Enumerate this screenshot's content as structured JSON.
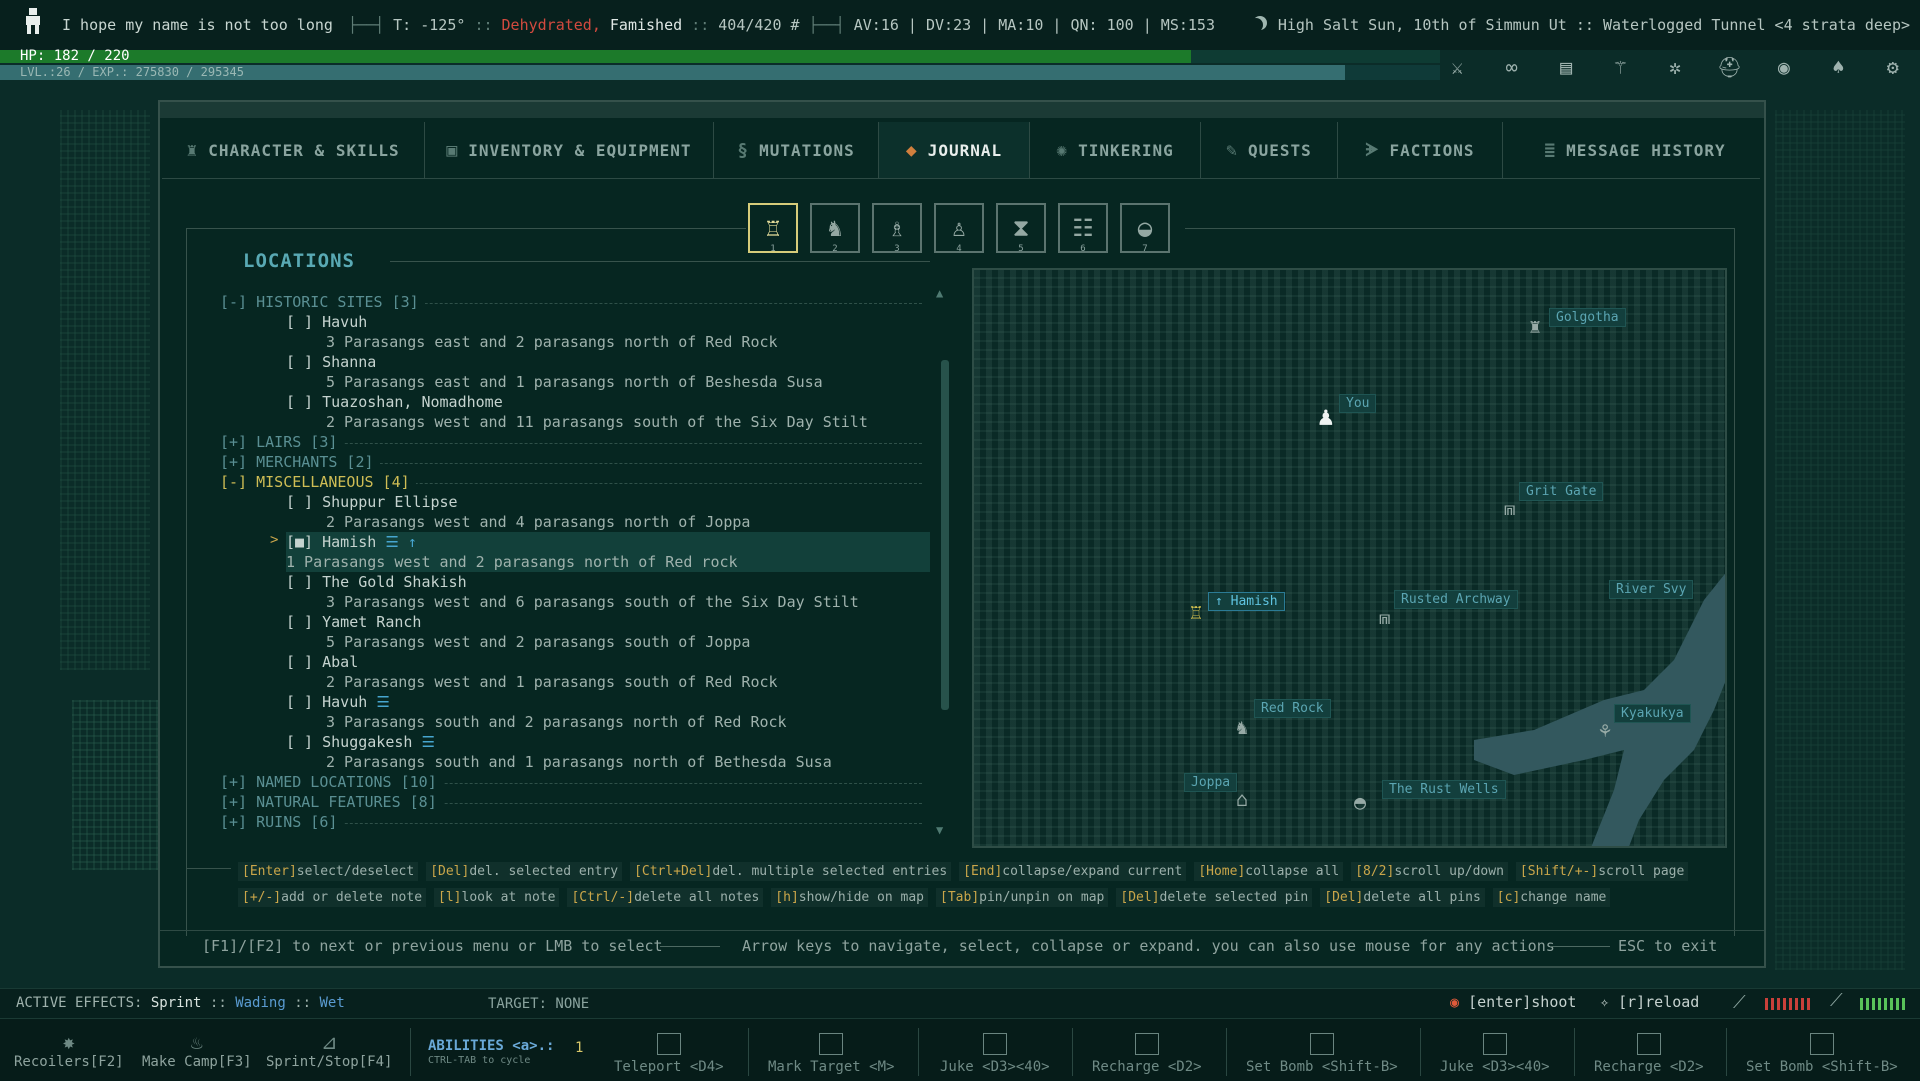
{
  "status": {
    "name": "I hope my name is not too long",
    "temp": "T: -125°",
    "conditions": [
      "Dehydrated,",
      "Famished"
    ],
    "weight": "404/420 #",
    "stats": "AV:16 | DV:23 | MA:10 | QN: 100 | MS:153",
    "date": "High Salt Sun, 10th of Simmun Ut",
    "location": "Waterlogged Tunnel <4 strata deep>",
    "hp_text": "HP: 182 / 220",
    "hp_fraction": 0.827,
    "xp_text": "LVL.:26 / EXP.: 275830 / 295345",
    "xp_fraction": 0.934
  },
  "toolbar_icons": [
    "sword-icon",
    "goggles-icon",
    "tablet-icon",
    "staff-icon",
    "gear-wheel-icon",
    "helmet-icon",
    "globe-icon",
    "hat-icon",
    "settings-icon"
  ],
  "tabs": [
    {
      "label": "CHARACTER & SKILLS",
      "icon": "person-icon"
    },
    {
      "label": "INVENTORY & EQUIPMENT",
      "icon": "chest-icon"
    },
    {
      "label": "MUTATIONS",
      "icon": "dna-icon"
    },
    {
      "label": "JOURNAL",
      "icon": "book-icon",
      "active": true
    },
    {
      "label": "TINKERING",
      "icon": "cog-icon"
    },
    {
      "label": "QUESTS",
      "icon": "quill-icon"
    },
    {
      "label": "FACTIONS",
      "icon": "wings-icon"
    },
    {
      "label": "MESSAGE HISTORY",
      "icon": "list-icon"
    }
  ],
  "subtabs": [
    "1",
    "2",
    "3",
    "4",
    "5",
    "6",
    "7"
  ],
  "locations": {
    "title": "LOCATIONS",
    "historic": {
      "label": "[-] HISTORIC SITES [3]",
      "entries": [
        {
          "name": "[ ] Havuh",
          "desc": "3 Parasangs east and 2 parasangs north of Red Rock"
        },
        {
          "name": "[ ] Shanna",
          "desc": "5 Parasangs east and 1 parasangs north of Beshesda Susa"
        },
        {
          "name": "[ ] Tuazoshan, Nomadhome",
          "desc": "2 Parasangs west and 11 parasangs south of the Six Day Stilt"
        }
      ]
    },
    "lairs": "[+] LAIRS [3]",
    "merchants": "[+] MERCHANTS [2]",
    "misc": {
      "label": "[-] MISCELLANEOUS [4]",
      "entries": [
        {
          "name": "[ ] Shuppur Ellipse",
          "desc": "2 Parasangs west and 4 parasangs north of Joppa"
        },
        {
          "name": "[■] Hamish",
          "desc": "1 Parasangs west and 2 parasangs north of Red rock",
          "note": "☰",
          "pin": "↑"
        },
        {
          "name": "[ ] The Gold Shakish",
          "desc": "3 Parasangs west and 6 parasangs south of the Six Day Stilt"
        },
        {
          "name": "[ ] Yamet Ranch",
          "desc": "5 Parasangs west and 2 parasangs south of Joppa"
        },
        {
          "name": "[ ] Abal",
          "desc": "2 Parasangs west and 1 parasangs south of Red Rock"
        },
        {
          "name": "[ ] Havuh",
          "desc": "3 Parasangs south and 2 parasangs north of Red Rock",
          "note": "☰"
        },
        {
          "name": "[ ] Shuggakesh",
          "desc": "2 Parasangs south and 1 parasangs north of Bethesda Susa",
          "note": "☰"
        }
      ]
    },
    "named": "[+] NAMED LOCATIONS [10]",
    "natural": "[+] NATURAL FEATURES [8]",
    "ruins": "[+] RUINS [6]"
  },
  "map_labels": {
    "golgotha": "Golgotha",
    "you": "You",
    "grit_gate": "Grit Gate",
    "river": "River Svy",
    "hamish": "Hamish",
    "hamish_pin": "↑",
    "rusted": "Rusted Archway",
    "red_rock": "Red Rock",
    "kyakukya": "Kyakukya",
    "joppa": "Joppa",
    "rust_wells": "The Rust Wells"
  },
  "hints": {
    "row1": [
      {
        "k": "[Enter]",
        "d": "select/deselect"
      },
      {
        "k": "[Del]",
        "d": "del. selected entry"
      },
      {
        "k": "[Ctrl+Del]",
        "d": "del. multiple selected entries"
      },
      {
        "k": "[End]",
        "d": "collapse/expand current"
      },
      {
        "k": "[Home]",
        "d": "collapse all"
      },
      {
        "k": "[8/2]",
        "d": "scroll up/down"
      },
      {
        "k": "[Shift/+-]",
        "d": "scroll page"
      }
    ],
    "row2": [
      {
        "k": "[+/-]",
        "d": "add or delete note"
      },
      {
        "k": "[l]",
        "d": "look at note"
      },
      {
        "k": "[Ctrl/-]",
        "d": "delete all notes"
      },
      {
        "k": "[h]",
        "d": "show/hide on map"
      },
      {
        "k": "[Tab]",
        "d": "pin/unpin on map"
      },
      {
        "k": "[Del]",
        "d": "delete selected pin"
      },
      {
        "k": "[Del]",
        "d": "delete all pins"
      },
      {
        "k": "[c]",
        "d": "change name"
      }
    ]
  },
  "footer": {
    "left": "[F1]/[F2] to next or previous menu or LMB to select",
    "middle": "Arrow keys to navigate, select, collapse or expand. you can also use mouse for any actions",
    "right": "ESC to exit"
  },
  "effects": {
    "label": "ACTIVE EFFECTS:",
    "e1": "Sprint",
    "sep": "::",
    "e2": "Wading",
    "e3": "Wet",
    "target": "TARGET: NONE",
    "shoot": "[enter]shoot",
    "reload": "[r]reload"
  },
  "abilities": {
    "left": [
      {
        "label": "Recoilers[F2]",
        "icon": "recoiler-icon"
      },
      {
        "label": "Make Camp[F3]",
        "icon": "campfire-icon"
      },
      {
        "label": "Sprint/Stop[F4]",
        "icon": "boot-icon"
      }
    ],
    "title": "ABILITIES <a>.:",
    "subtitle": "CTRL-TAB to cycle",
    "count": "1",
    "slots": [
      "Teleport <D4>",
      "Mark Target <M>",
      "Juke <D3><40>",
      "Recharge <D2>",
      "Set Bomb <Shift-B>",
      "Juke <D3><40>",
      "Recharge <D2>",
      "Set Bomb <Shift-B>"
    ]
  }
}
